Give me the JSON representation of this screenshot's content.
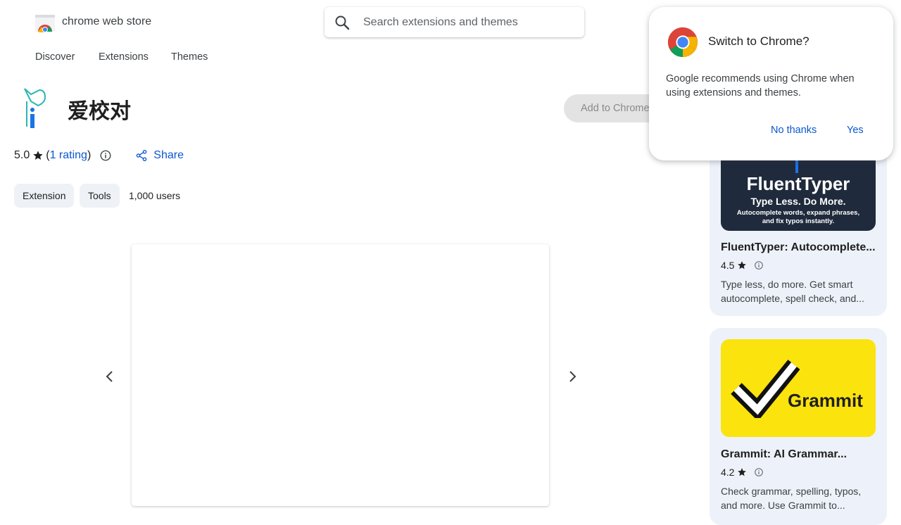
{
  "header": {
    "brand": "chrome web store",
    "search_placeholder": "Search extensions and themes"
  },
  "nav": {
    "items": [
      {
        "label": "Discover"
      },
      {
        "label": "Extensions"
      },
      {
        "label": "Themes"
      }
    ]
  },
  "extension": {
    "title": "爱校对",
    "add_button": "Add to Chrome",
    "rating_value": "5.0",
    "rating_open": "(",
    "rating_link": "1 rating",
    "rating_close": ")",
    "share_label": "Share",
    "chips": [
      "Extension",
      "Tools"
    ],
    "users": "1,000 users"
  },
  "related": [
    {
      "banner_name": "FluentTyper",
      "banner_tagline": "Type Less. Do More.",
      "banner_sub1": "Autocomplete words, expand phrases,",
      "banner_sub2": "and fix typos instantly.",
      "title": "FluentTyper: Autocomplete...",
      "rating": "4.5",
      "desc": "Type less, do more. Get smart autocomplete, spell check, and..."
    },
    {
      "banner_name": "Grammit",
      "title": "Grammit: AI Grammar...",
      "rating": "4.2",
      "desc": "Check grammar, spelling, typos, and more. Use Grammit to..."
    }
  ],
  "popup": {
    "title": "Switch to Chrome?",
    "body": "Google recommends using Chrome when using extensions and themes.",
    "no_button": "No thanks",
    "yes_button": "Yes"
  },
  "colors": {
    "link": "#0b57d0",
    "card_bg": "#edf2fa",
    "grammit_yellow": "#fbe30e",
    "fluenttyper_navy": "#1f2a3c"
  }
}
